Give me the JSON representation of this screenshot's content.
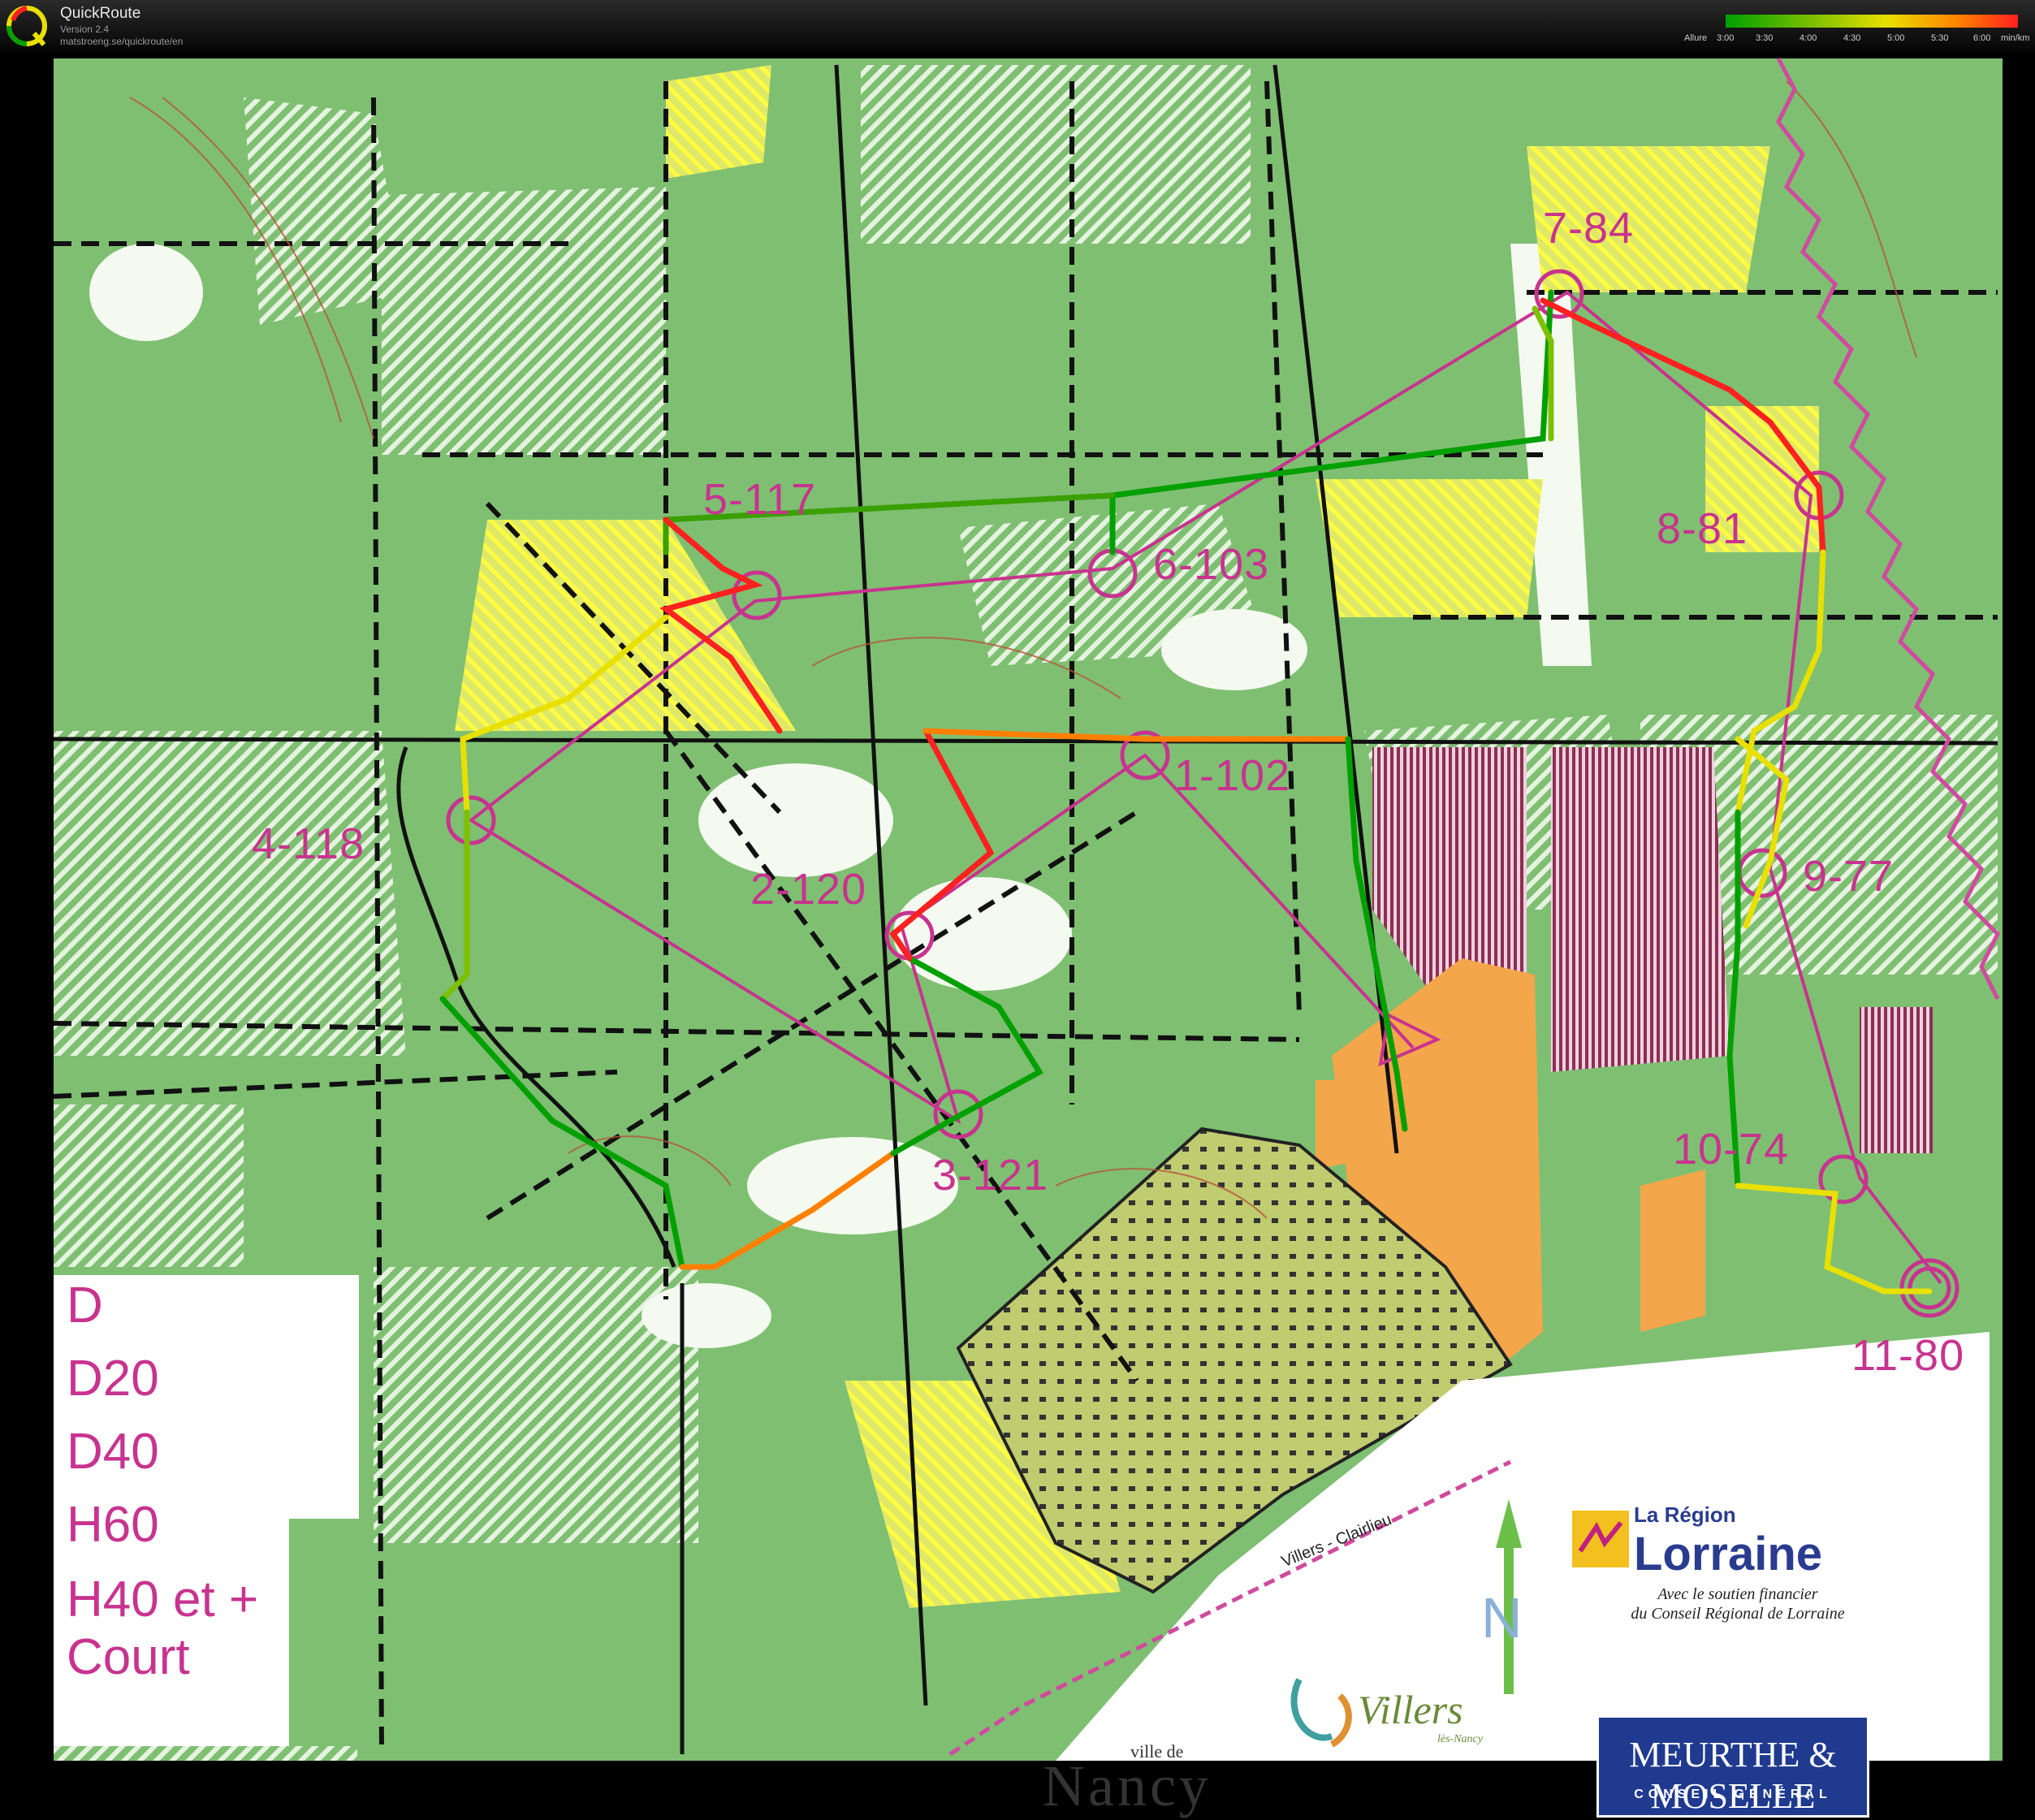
{
  "app": {
    "name": "QuickRoute",
    "version": "Version 2.4",
    "url": "matstroeng.se/quickroute/en"
  },
  "pace_legend": {
    "prefix": "Allure",
    "ticks": [
      "3:00",
      "3:30",
      "4:00",
      "4:30",
      "5:00",
      "5:30",
      "6:00"
    ],
    "unit": "min/km",
    "colors": [
      "#00a000",
      "#7dc000",
      "#e8e000",
      "#ff8000",
      "#ff2020"
    ]
  },
  "controls": [
    {
      "id": "1-102"
    },
    {
      "id": "2-120"
    },
    {
      "id": "3-121"
    },
    {
      "id": "4-118"
    },
    {
      "id": "5-117"
    },
    {
      "id": "6-103"
    },
    {
      "id": "7-84"
    },
    {
      "id": "8-81"
    },
    {
      "id": "9-77"
    },
    {
      "id": "10-74"
    },
    {
      "id": "11-80"
    }
  ],
  "classes": [
    "D",
    "D20",
    "D40",
    "H60",
    "H40 et + Court"
  ],
  "logos": {
    "region_small": "La Région",
    "region_big": "Lorraine",
    "region_sub1": "Avec le soutien financier",
    "region_sub2": "du Conseil Régional de Lorraine",
    "villers": "Villers",
    "villers_sub": "lès-Nancy",
    "nancy_small": "ville de",
    "nancy_big": "Nancy",
    "mm": "MEURTHE & MOSELLE",
    "mm_sub": "CONSEIL GÉNÉRAL"
  },
  "map_labels": {
    "road": "Villers - Clairlieu"
  },
  "colors": {
    "forest": "#7fbf72",
    "open": "#ffffff",
    "rough": "#ffff40",
    "course": "#c8338f",
    "urban": "#f4a64b",
    "housing": "#b8c86a"
  }
}
